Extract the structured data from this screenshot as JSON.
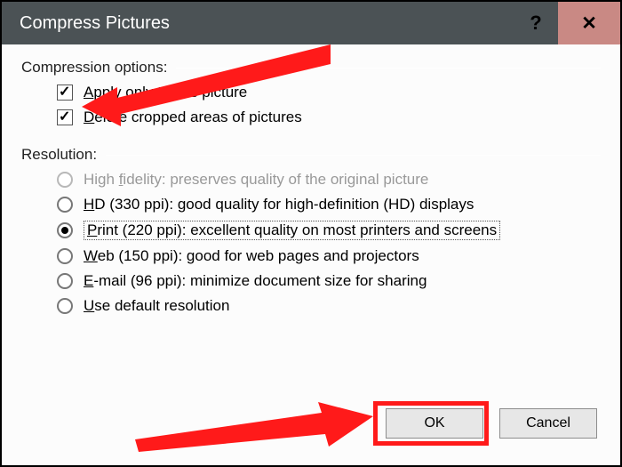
{
  "title": "Compress Pictures",
  "compression_label": "Compression options:",
  "apply_only": "Apply only to this picture",
  "delete_cropped": "Delete cropped areas of pictures",
  "resolution_label": "Resolution:",
  "res_high": "High fidelity: preserves quality of the original picture",
  "res_hd": "HD (330 ppi): good quality for high-definition (HD) displays",
  "res_print": "Print (220 ppi): excellent quality on most printers and screens",
  "res_web": "Web (150 ppi): good for web pages and projectors",
  "res_email": "E-mail (96 ppi): minimize document size for sharing",
  "res_default": "Use default resolution",
  "ok": "OK",
  "cancel": "Cancel"
}
